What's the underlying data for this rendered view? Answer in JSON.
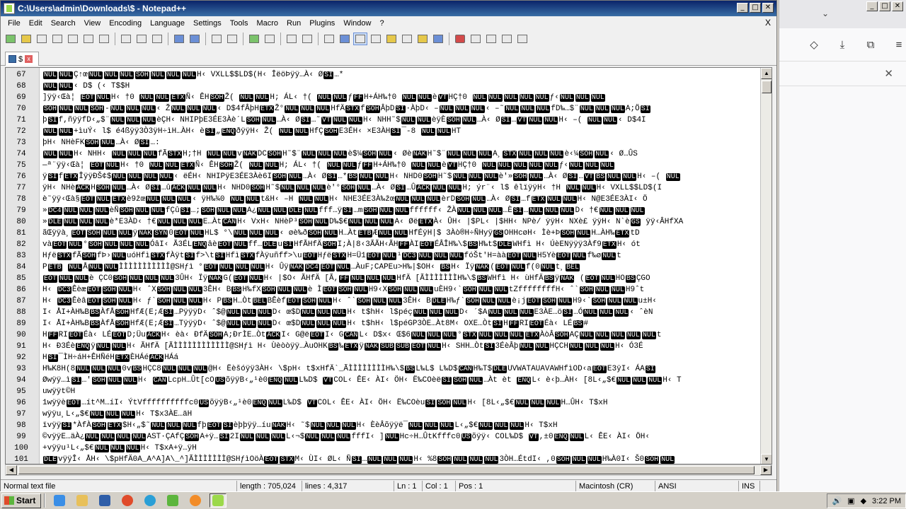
{
  "window": {
    "title": "C:\\Users\\admin\\Downloads\\$ - Notepad++",
    "minimize_label": "_",
    "maximize_label": "□",
    "close_label": "✕"
  },
  "menu": {
    "items": [
      "File",
      "Edit",
      "Search",
      "View",
      "Encoding",
      "Language",
      "Settings",
      "Tools",
      "Macro",
      "Run",
      "Plugins",
      "Window",
      "?"
    ],
    "close_label": "X"
  },
  "tab": {
    "label": "$",
    "close_label": "x"
  },
  "editor": {
    "lines": [
      {
        "n": "67",
        "t": "NULNULÇ↑œNULNULNULSOHNULNULNULH‹ VXLL$$LD$(H‹ ÎëöÞÿÿ…À‹ ØSI…*"
      },
      {
        "n": "68",
        "t": "NULNUL‹ D$ (‹ T$$H"
      },
      {
        "n": "69",
        "t": "]ÿÿ‹Œà¦ EOTNULH‹ †0   NULNULETXÑ‹ ÊHSOHŽ( NULNULH; ÁL‹ †(   NULNULƒFFH+ÁH‰†0   NULNULèVTHÇ†0   NULNULNULNULNULƒ‹NULNULNUL"
      },
      {
        "n": "70",
        "t": "SOHNULNULSOH-NULNULNUL‹ ŽNULNULNUL‹ D$4fÂþHETXŽ°NULNULNULHfÄSTXfSOHÂþDSI·ÀþD‹ –NULNULNUL‹ –˜NULNULNULfD‰…$¨NULNULNULA;ÖSI"
      },
      {
        "n": "71",
        "t": "þSIf,ñÿÿfD‹„$¨NULNULNULèÇH‹ NHIPþE3ÉE3Àè´LSOHNUL…À‹ ØSI…˜VTNULNULH‹ NHH˜$NULNULèÿÈSOHNUL…À‹ ØSI…VTNULNULH‹ –( NULNUL‹ D$4I"
      },
      {
        "n": "72",
        "t": "NULNUL+ìuÝ‹ l$  é4ßÿÿ3Ò3ÿH÷ìH…ÀH‹ èSI„ENQðÿÿH‹ Ž(  NULNULHfÇSOHE3ÉH‹ ×E3ÀHSI¯-8    NULNULHT"
      },
      {
        "n": "73",
        "t": "þH‹ NHèFKSOHNUL…À‹ ØSI…:"
      },
      {
        "n": "74",
        "t": "NULNULH‹ NHH‹ NULNULNULfÃSTXH;†H   NULNULvNAKDCSOHH˜$¨NULNULNULè$¼SOHNUL‹ ØèNAKH˜$¨NULNULNULA¸STXNULNULNULè‹¼SOHNUL‹ Ø…ÛS"
      },
      {
        "n": "75",
        "t": "—ª¨ÿÿ‹Œà¦ EOTNULH‹ †0   NULNULETXÑ‹ ÊHSOHŽ( NULNULH; ÁL‹ †(   NULNULƒFFH+ÁH‰†0   NULNULèVTHÇ†0   NULNULNULNULNULƒ‹NULNULNUL"
      },
      {
        "n": "76",
        "t": "ÿSIfETXÎÿÿÐŠ¢$NULNULNULNUL‹ ëÉH‹ NHIPÿE3ÉE3Àè6ISOHNUL…À‹ ØSI…*BSNULNULH‹ NHD0SOHH˜$NULNULNULè'»SOHNUL…À‹ ØSI…VTBSNULNULH‹ –(   NUL"
      },
      {
        "n": "77",
        "t": "ÿH‹ NHèACKHSOHNUL…À‹ ØSI…ûACKNULNULH‹ NHD0SOHH˜$NULNULNULè'°SOHNUL…À‹ ØSI…ÛACKNULNULH; ýr¨‹ l$  êlïÿÿH‹ †H    NULNULH‹ VXLL$$LD$(I"
      },
      {
        "n": "78",
        "t": "è˜ÿÿ‹Œà§EOTNULETXè9žœNULNULNUL‹ ÿH‰¾0   NULNULt&H‹ –H    NULNULH‹ NHE3ÉE3À‰žœNULNULNULèrDSOHNUL…À‹ ØSI…fETXNULNULH‹ N@E3ÉE3ÀI‹ Ö"
      },
      {
        "n": "79",
        "t": "»DC4NULNULNULèÑSOHNULNULfÇûSI…;SOHNULNULA¿NULNULDLENULfff…ÿSI…mSOHNULNULffffff‹ ŽÀNULNULNUL…ÈSI…NULNULNULD‹ †€NULNULNUL"
      },
      {
        "n": "80",
        "t": "»DLENULNULNULè*E3ÀD‹ †€NULNULNULE…ÀtCANH‹ VxH‹ NHèP³SOHNULD‰$€NULNULNULA‹ ØëETXÀ‹ ÛH‹ |$PL‹ |$HH‹ NPè/  ÿÿH‹ NXè£ ÿÿH‹ N`èGS  ÿÿ‹ÂHfXA"
      },
      {
        "n": "81",
        "t": "ãŒÿÿà¸EOTSOHNULNULÿNAKSYN0EOTNULHL$  °\\NULNULNUL‹ øè‰ðSOHNULH…ÀtETBÆNULNULHfÉÿH|$ 3Àò®H÷ÑHyÿGSOHHcøH‹ Ìè+ÞSOHNULH…ÀH‰ETXtD"
      },
      {
        "n": "82",
        "t": "vàEOTNUL°SOHNULNULNULÓâI‹ Ã3ÉLENQâèEOTNULff…DLEuSIHfÃHfÄSOHI;À|8‹3ÃÃH‹ÃHFFÀIEOTÉÂÎH‰\\$BSH‰t$DLEWHfì H‹ ÚèENÿÿÿ3Àf9ETXH‹ ót"
      },
      {
        "n": "83",
        "t": "HƒëSTXfÃSOHfÞ›NULuóHfìSTXfÀÿtSIf>\\tSIHfìSTXfÀÿuñff>\\uEOTHƒëSTXH=Ü1EOTNUL¹DC3NULNULNULfóŠt'H=ààEOTNULH5YèEOTNULf‰øNULt"
      },
      {
        "n": "84",
        "t": "PETB    NULÅNULNULÌÌÌÌÌÌÌÌÌÌÌ@SHƒì °EOTNULNULNULH‹ ÛÿNAKDC4EOTNUL…ÀuF;CAPEu>H‰|$OH‹ BSH‹ ÏÿNAK(EOTNULf(0NULt¸BEL"
      },
      {
        "n": "85",
        "t": "EOTNULNULè ÇC0SOHNULNULNUL3ÛH‹ ÏÿNAKG(EOTNULH‹ |$O‹ ÃHfÄ [Ã,FFNULNULNULHfÄ [ÃÌÌÌÌÌÌÌH‰\\$BSWHfì H‹ ùHfÄBSÿNAK  (EOTNULHOBSÇGO"
      },
      {
        "n": "86",
        "t": "H‹ DC3ÊèæEOTSOHNULH‹ ˆXSOHNULNUL3ÊH‹ BBSH‰fXSOHNULNULè ÌEOTSOHNULH9‹XSOHNULNULuÈH9‹`SOHNULNULtZffffffffH‹ ˆ`SOHNULNULH9ˆt"
      },
      {
        "n": "87",
        "t": "H‹ DC3ÊèâEOTSOHNULH‹ ƒ`SOHNULNULH‹ PBSH…ÒtBELBÊèfEOTSOHNULH‹ ˆ`SOHNULNUL3ÊH‹ BDLEH‰ƒ`SOHNULNULè¡jEOTSOHNULH9‹`SOHNULNULu±H‹"
      },
      {
        "n": "88",
        "t": "I‹ ÅI+ÀH‰BBSÀfÅSOHHfÆ(E;ÆSI…PÿÿÿD‹ ˆ$@NULNULNULD‹ œ$DNULNULNULH‹ t$hH‹ l$péçNULNULNULD‹ ´$ANULNULNULE3ÀE…öSI…ÓNULNULNUL‹ ˆèN"
      },
      {
        "n": "89",
        "t": "I‹ ÅI+ÀH‰BBSÀfÅSOHHfÆ(E;ÆSI…TÿÿÿD‹ ˆ$@NULNULNULD‹ œ$DNULNULNULH‹ t$hH‹ l$péGP3ÒE…Àt8M‹ OXE…ÒtSIHFFRIEOTÉà‹ LÉBS#"
      },
      {
        "n": "90",
        "t": "HFFRIEOTÉà‹ LÉEOTD;ÜuACKH‹ èà‹ ÐfÄSOHA;ÐrÌE…ÒtACKI‹ G@ëEOTI‹ GCANL‹ D$x‹ Œ$6NULNULNUL°STXNULNULNULETXÀòÂSOHAÇNULNULNULNULNULt"
      },
      {
        "n": "91",
        "t": "H‹ Ð3ÉèENQÿNULNULH‹ ÃHfÄ [ÃÌÌÌÌÌÌÌÌÌÌÌÌ@SHƒì H‹ Ùèòòÿÿ…ÀuOHKBS‰ETXÿNAKSUBSUBEOTNULH‹ SHH…ÒtSI3ÉèÂþNULNULHÇCHNULNULNULH‹ Ó3É"
      },
      {
        "n": "92",
        "t": "HSI¯ÌH÷áH+ÊHÑéHETXÈHÁéACKHÁá"
      },
      {
        "n": "93",
        "t": "H‰K8H(8NULNULNUL0vBSHÇC8NULNULNUL@H‹ Ëèšóÿÿ3ÀH‹ \\$pH‹ t$xHfÄ`_ÃÌÌÌÌÌÌÌÌH‰\\$BSL‰L$  L‰D$CANH‰T$DLEUVWATAUAVAWHfìOD‹aEOTE3ÿI‹ ÁASI"
      },
      {
        "n": "94",
        "t": "Øwÿÿ…ìSI…'SOHNULNULH‹ CANLcpH…Ût[cOUSõÿÿB‹„¹è0ENQNULL‰D$  VTCOL‹ ÊE‹ ÀI‹ ÖH‹ Ë‰COèëSISOHNUL…Àt èt ENQL‹ è‹þ…ÀH‹ [8L‹„$€NULNULNULH‹ T"
      },
      {
        "n": "95",
        "t": "uwÿÿt©H"
      },
      {
        "n": "96",
        "t": "1wÿÿèEOT…ít^M…íI‹ ÝtVffffffffffc0USõÿÿB‹„¹è0ENQNULL‰D$  VTCOL‹ ÊE‹ ÀI‹ ÖH‹ Ë‰COèuSISOHNULH‹ [8L‹„$€NULNULNULH…ÛH‹ T$xH"
      },
      {
        "n": "97",
        "t": "wÿÿu¸L‹„$€NULNULNULH‹ T$x3ÀE…äH"
      },
      {
        "n": "98",
        "t": "ïvÿÿSI*ÀfÀSOHETX$H‹„$˜NULNULNULfþEOTSIèþþÿÿ…íuNAKH‹ ˜$NULNULNULH‹ ÈèÂõÿÿë¯NULNULNULL‹„$€NULNULNULH‹ T$xH"
      },
      {
        "n": "99",
        "t": "©vÿÿE…äÀ¿NULNULNULNULAST·ÇAfÇSOHA+ÿ…SI2INULNULNULL‹¬$NULNULNULfffI‹ ]NULHc÷H…ÛtKfffc0USõÿÿ‹ COL‰D$ VT,±0ENQNULL‹ ÊE‹ ÀI‹ ÖH‹"
      },
      {
        "n": "100",
        "t": "+vÿÿu¹L‹„$€NULNULNULH‹ T$xA+ÿ…ÿH"
      },
      {
        "n": "101",
        "t": "DLEvÿÿÎ‹ ÅH‹ \\$pHfÄ0A_A^A]A\\_^]ÃÌÌÌÌÌÌÌ@SHƒìOöÀEOTSTXM‹ ÙI‹ ØL‹ ÑSI…NULNULNULH‹ %8SOHNULNULNUL3ÒH…ÉtdI‹ ,0SOHNULNULH‰À0I‹ Š0SOHNUL"
      }
    ]
  },
  "status": {
    "file_type": "Normal text file",
    "length": "length : 705,024",
    "lines": "lines : 4,317",
    "ln": "Ln : 1",
    "col": "Col : 1",
    "pos": "Pos : 1",
    "eol": "Macintosh (CR)",
    "encoding": "ANSI",
    "mode": "INS"
  },
  "taskbar": {
    "start_label": "Start",
    "clock": "3:22 PM"
  },
  "icons": {
    "toolbar": [
      "new-file-icon",
      "open-file-icon",
      "save-icon",
      "save-all-icon",
      "close-icon",
      "close-all-icon",
      "print-icon",
      "cut-icon",
      "copy-icon",
      "paste-icon",
      "undo-icon",
      "redo-icon",
      "find-icon",
      "replace-icon",
      "zoom-in-icon",
      "zoom-out-icon",
      "sync-vertical-icon",
      "sync-horizontal-icon",
      "word-wrap-icon",
      "show-all-chars-icon",
      "indent-guide-icon",
      "user-lang-icon",
      "doc-map-icon",
      "function-list-icon",
      "folder-workspace-icon",
      "monitoring-icon",
      "record-macro-icon",
      "stop-record-icon",
      "playback-icon",
      "run-macro-multiple-icon",
      "save-macro-icon"
    ]
  }
}
